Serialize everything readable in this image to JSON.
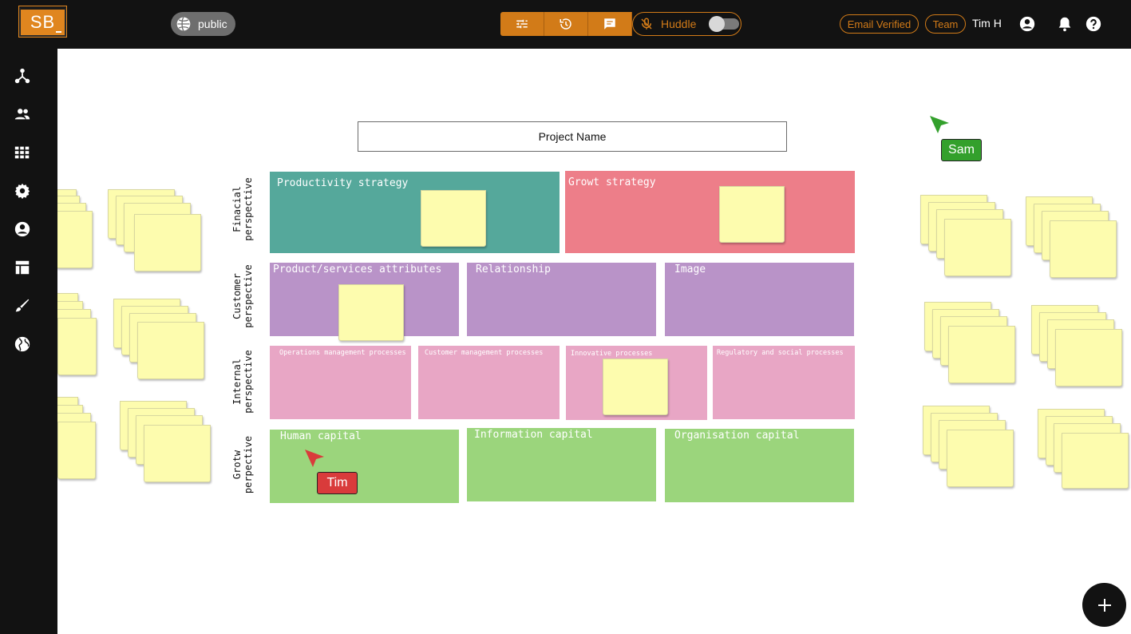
{
  "topbar": {
    "logo_text": "SB",
    "visibility": "public",
    "huddle_label": "Huddle",
    "email_status": "Email Verified",
    "team_label": "Team",
    "user_name": "Tim H"
  },
  "board": {
    "project_name": "Project Name",
    "rows": [
      {
        "line1": "Finacial",
        "line2": "perspective"
      },
      {
        "line1": "Customer",
        "line2": "perspective"
      },
      {
        "line1": "Internal",
        "line2": "perspective"
      },
      {
        "line1": "Grotw",
        "line2": "perpective"
      }
    ],
    "cells": {
      "productivity": "Productivity strategy",
      "growth": "Growt strategy",
      "product_services": "Product/services attributes",
      "relationship": "Relationship",
      "image": "Image",
      "operations": "Operations management processes",
      "customer_mgmt": "Customer management processes",
      "innovative": "Innovative processes",
      "regulatory": "Regulatory and social processes",
      "human": "Human capital",
      "information": "Information capital",
      "organisation": "Organisation capital"
    },
    "colors": {
      "teal": "#55a89b",
      "red": "#ed7e89",
      "purple": "#b993c8",
      "pink": "#e8a6c5",
      "green": "#9bd57c",
      "accent": "#d27b18"
    }
  },
  "cursors": {
    "sam": "Sam",
    "tim": "Tim"
  },
  "icons": {
    "sidebar": [
      "network-icon",
      "people-icon",
      "grid-icon",
      "settings-icon",
      "account-icon",
      "layout-icon",
      "brush-icon",
      "globe-icon"
    ]
  }
}
